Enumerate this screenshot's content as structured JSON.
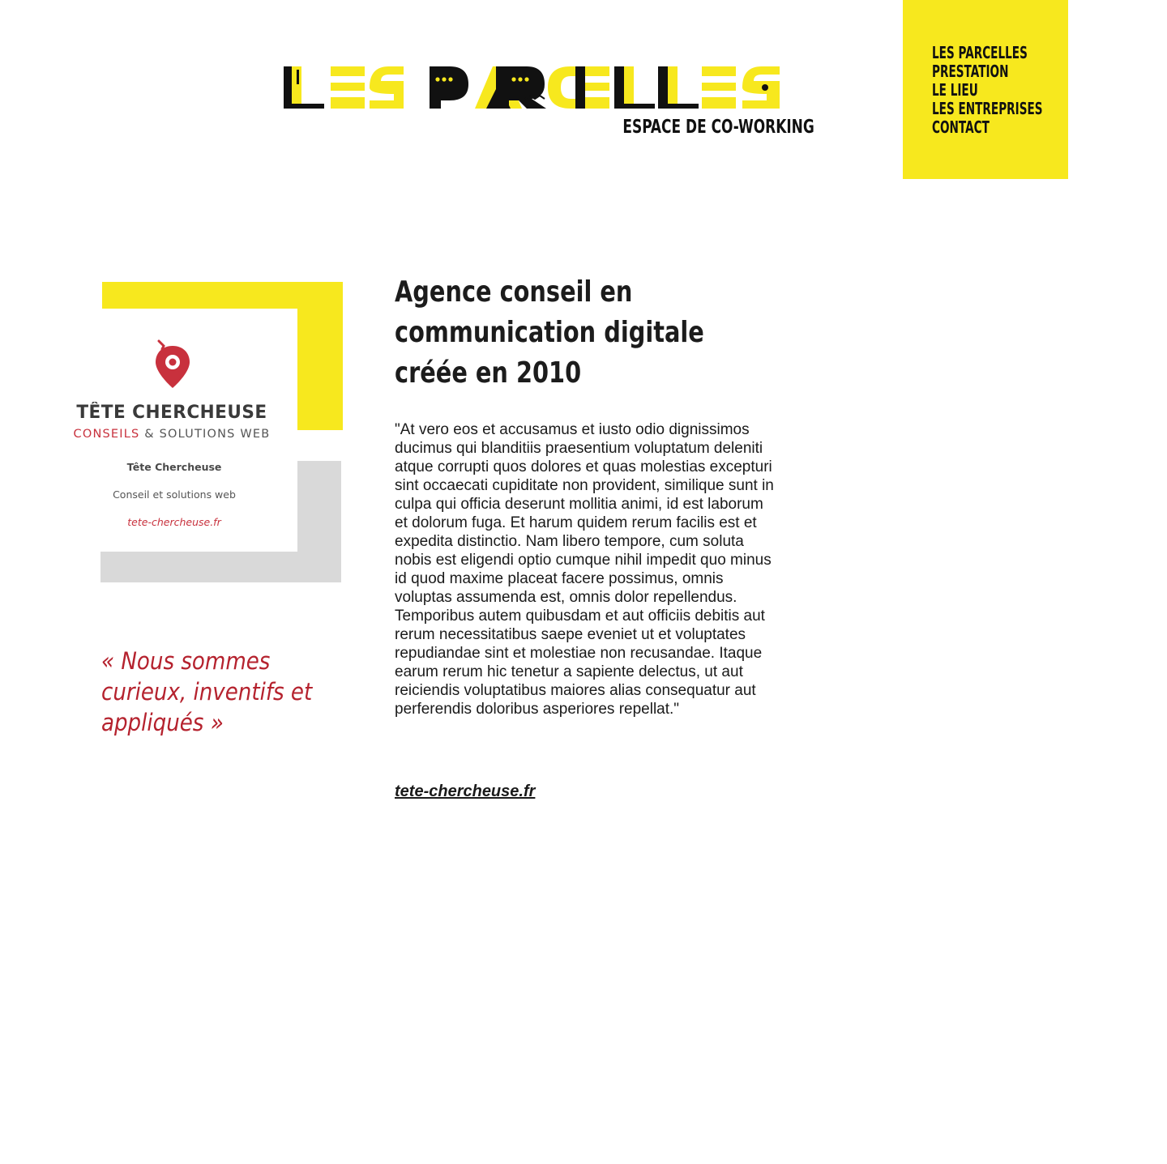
{
  "header": {
    "logo_text": "LES PARCELLES",
    "subtitle": "ESPACE DE CO-WORKING"
  },
  "nav": {
    "items": [
      {
        "label": "LES PARCELLES"
      },
      {
        "label": "PRESTATION"
      },
      {
        "label": "LE LIEU"
      },
      {
        "label": "LES ENTREPRISES"
      },
      {
        "label": "CONTACT"
      }
    ]
  },
  "company_card": {
    "name": "TÊTE CHERCHEUSE",
    "tagline_part1": "CONSEILS",
    "tagline_part2": " & SOLUTIONS WEB",
    "line1": "Tête Chercheuse",
    "line2": "Conseil et solutions web",
    "line3": "tete-chercheuse.fr"
  },
  "quote": "« Nous sommes curieux, inventifs et appliqués »",
  "main": {
    "title": "Agence conseil en communication digitale créée en 2010",
    "body": "\"At vero eos et accusamus et iusto odio dignissimos ducimus qui blanditiis praesentium voluptatum deleniti atque corrupti quos dolores et quas molestias excepturi sint occaecati cupiditate non provident, similique sunt in culpa qui officia deserunt mollitia animi, id est laborum et dolorum fuga. Et harum quidem rerum facilis est et expedita distinctio. Nam libero tempore, cum soluta nobis est eligendi optio cumque nihil impedit quo minus id quod maxime placeat facere possimus, omnis voluptas assumenda est, omnis dolor repellendus. Temporibus autem quibusdam et aut officiis debitis aut rerum necessitatibus saepe eveniet ut et voluptates repudiandae sint et molestiae non recusandae. Itaque earum rerum hic tenetur a sapiente delectus, ut aut reiciendis voluptatibus maiores alias consequatur aut perferendis doloribus asperiores repellat.\"",
    "link": "tete-chercheuse.fr"
  },
  "colors": {
    "accent_yellow": "#f7e81e",
    "grey_block": "#d9d9d9",
    "brand_red": "#c8313d",
    "quote_red": "#b5222e",
    "text_dark": "#1a1a1a"
  },
  "icons": {
    "logo": "les-parcelles-logo",
    "card": "map-pin-icon"
  }
}
